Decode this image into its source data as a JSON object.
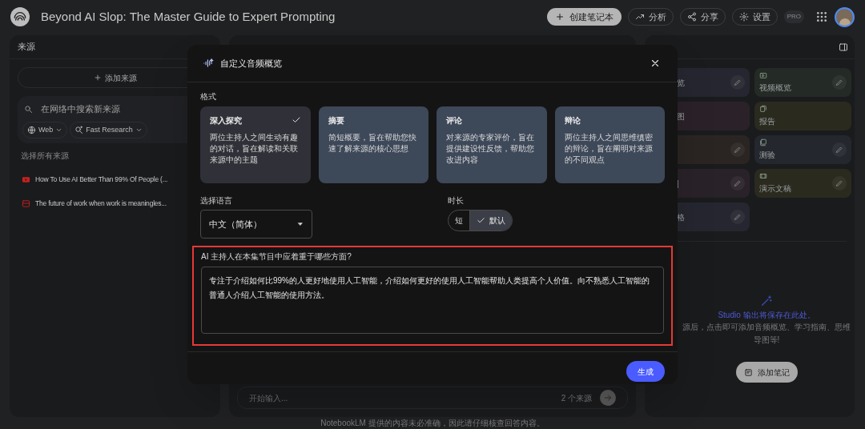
{
  "header": {
    "title": "Beyond AI Slop: The Master Guide to Expert Prompting",
    "actions": [
      {
        "label": "创建笔记本",
        "kind": "create"
      },
      {
        "label": "分析",
        "kind": "analytics"
      },
      {
        "label": "分享",
        "kind": "share"
      },
      {
        "label": "设置",
        "kind": "settings"
      }
    ],
    "badge": "PRO"
  },
  "sources_panel": {
    "title": "来源",
    "add_button": "添加来源",
    "search": {
      "placeholder": "在网络中搜索新来源"
    },
    "filters": [
      {
        "label": "Web",
        "kind": "web"
      },
      {
        "label": "Fast Research",
        "kind": "research"
      }
    ],
    "select_all": "选择所有来源",
    "items": [
      {
        "title": "How To Use AI Better Than 99% Of People (...",
        "kind": "video"
      },
      {
        "title": "The future of work when work is meaningles...",
        "kind": "pdf"
      }
    ]
  },
  "chat_panel": {
    "input": {
      "placeholder": "开始输入..."
    },
    "source_count": "2 个来源"
  },
  "studio_panel": {
    "tiles": [
      {
        "label": "览",
        "color": "#25262f",
        "editable": true
      },
      {
        "label": "视频概览",
        "color": "#242a25",
        "editable": true,
        "kind": "video"
      },
      {
        "label": "图",
        "color": "#2b2229",
        "editable": false
      },
      {
        "label": "报告",
        "color": "#2b2a1f",
        "editable": false,
        "kind": "report"
      },
      {
        "color": "#2a2523",
        "editable": true
      },
      {
        "label": "测验",
        "color": "#24272d",
        "editable": true,
        "kind": "quiz"
      },
      {
        "label": "|",
        "color": "#2a2229",
        "editable": true
      },
      {
        "label": "演示文稿",
        "color": "#2b2a1f",
        "editable": true,
        "kind": "slides"
      },
      {
        "label": "格",
        "color": "#25262f",
        "editable": true
      }
    ],
    "empty_title": "Studio 输出将保存在此处。",
    "empty_text": "源后，点击即可添加音频概览、学习指南、思维导图等!",
    "add_note": "添加笔记"
  },
  "footer": "NotebookLM 提供的内容未必准确，因此请仔细核查回答内容。",
  "dialog": {
    "title": "自定义音频概览",
    "format_label": "格式",
    "formats": [
      {
        "title": "深入探究",
        "description": "两位主持人之间生动有趣的对话，旨在解读和关联来源中的主题",
        "selected": true
      },
      {
        "title": "摘要",
        "description": "简短概要，旨在帮助您快速了解来源的核心思想",
        "selected": false
      },
      {
        "title": "评论",
        "description": "对来源的专家评价，旨在提供建设性反馈，帮助您改进内容",
        "selected": false
      },
      {
        "title": "辩论",
        "description": "两位主持人之间思维缜密的辩论，旨在阐明对来源的不同观点",
        "selected": false
      }
    ],
    "language_label": "选择语言",
    "language": "中文（简体）",
    "duration_label": "时长",
    "durations": [
      {
        "label": "短",
        "selected": false
      },
      {
        "label": "默认",
        "selected": true
      }
    ],
    "prompt_label": "AI 主持人在本集节目中应着重于哪些方面?",
    "prompt": "专注于介绍如何比99%的人更好地使用人工智能，介绍如何更好的使用人工智能帮助人类提高个人价值。向不熟悉人工智能的普通人介绍人工智能的使用方法。",
    "generate": "生成"
  }
}
